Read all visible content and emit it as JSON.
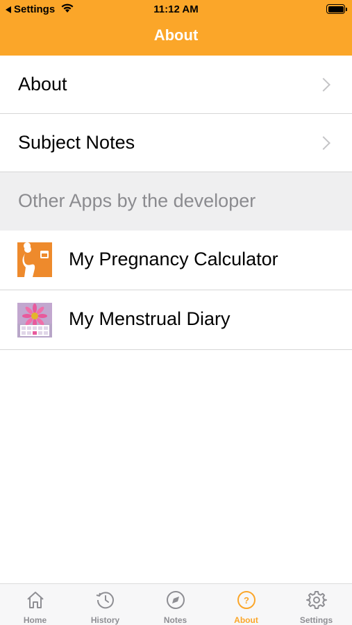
{
  "status_bar": {
    "back_app": "Settings",
    "time": "11:12 AM"
  },
  "nav": {
    "title": "About"
  },
  "rows": [
    {
      "label": "About"
    },
    {
      "label": "Subject Notes"
    }
  ],
  "section": {
    "header": "Other Apps by the developer"
  },
  "apps": [
    {
      "label": "My Pregnancy Calculator",
      "icon": "pregnancy-calculator-app-icon"
    },
    {
      "label": "My Menstrual Diary",
      "icon": "menstrual-diary-app-icon"
    }
  ],
  "tabs": [
    {
      "label": "Home",
      "icon": "home-icon"
    },
    {
      "label": "History",
      "icon": "history-icon"
    },
    {
      "label": "Notes",
      "icon": "compass-icon"
    },
    {
      "label": "About",
      "icon": "question-icon",
      "active": true
    },
    {
      "label": "Settings",
      "icon": "gear-icon"
    }
  ],
  "colors": {
    "accent": "#fba629",
    "inactive_tab": "#8e8e93",
    "section_bg": "#efeff0",
    "section_text": "#8b8b8f"
  }
}
